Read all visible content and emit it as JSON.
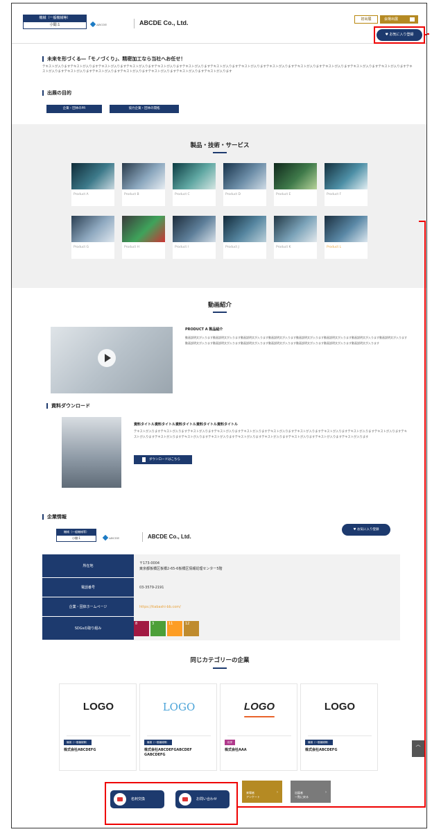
{
  "header": {
    "category_top": "機械（一般機械等）",
    "category_bottom": "小間:1",
    "logo_text": "ABCDE",
    "company_name": "ABCDE Co., Ltd.",
    "visit_button": "初出展",
    "venue_button": "会場出展",
    "favorite_button": "お気に入り登録"
  },
  "intro": {
    "title": "未来を形づくる―「モノづくり」、精密加工なら当社へお任せ！",
    "body": "テキストが入りますテキストが入りますテキストが入りますテキストが入りますテキストが入りますテキストが入りますテキストが入りますテキストが入りますテキストが入りますテキストが入りますテキストが入りますテキストが入りますテキストが入りますテキストが入りますテキストが入りますテキストが入りますテキストが入りますテキストが入りますテキストが入りますテキストが入ります"
  },
  "purpose": {
    "title": "出展の目的",
    "tags": [
      "企業・団体のPR",
      "協力企業・団体の開拓"
    ]
  },
  "products": {
    "title": "製品・技術・サービス",
    "items": [
      {
        "label": "Product A"
      },
      {
        "label": "Product B"
      },
      {
        "label": "Product C"
      },
      {
        "label": "Product D"
      },
      {
        "label": "Product E"
      },
      {
        "label": "Product F"
      },
      {
        "label": "Product G"
      },
      {
        "label": "Product H"
      },
      {
        "label": "Product I"
      },
      {
        "label": "Product J"
      },
      {
        "label": "Product K"
      },
      {
        "label": "Product L"
      }
    ]
  },
  "video": {
    "section_title": "動画紹介",
    "title": "PRODUCT A 製品紹介",
    "body": "動画説明文が入ります動画説明文が入ります動画説明文が入ります動画説明文が入ります動画説明文が入ります動画説明文が入ります動画説明文が入ります動画説明文が入ります動画説明文が入ります動画説明文が入ります動画説明文が入ります動画説明文が入ります動画説明文が入ります動画説明文が入ります動画説明文が入ります"
  },
  "download": {
    "section_title": "資料ダウンロード",
    "title": "資料タイトル資料タイトル資料タイトル資料タイトル資料タイトル",
    "body": "テキストが入りますテキストが入りますテキストが入りますテキストが入りますテキストが入りますテキストが入りますテキストが入りますテキストが入りますテキストが入りますテキストが入りますテキストが入りますテキストが入りますテキストが入りますテキストが入りますテキストが入りますテキストが入りますテキストが入りますテキストが入りますテキストが入ります",
    "button": "ダウンロードはこちら"
  },
  "company": {
    "section_title": "企業情報",
    "category_top": "機械（一般機械等）",
    "category_bottom": "小間:1",
    "logo_text": "ABCDE",
    "name": "ABCDE Co., Ltd.",
    "favorite_button": "お気に入り登録",
    "rows": [
      {
        "key": "所在地",
        "value": "〒173-0004\n東京都板橋区板橋2-65-6板橋区情報処理センター5階"
      },
      {
        "key": "電話番号",
        "value": "03-3579-2191"
      },
      {
        "key": "企業・団体ホームページ",
        "value": "https://itabashi-bb.com/"
      },
      {
        "key": "SDGsの取り組み",
        "value": ""
      }
    ],
    "sdgs": [
      {
        "num": "8",
        "color": "#a21942"
      },
      {
        "num": "3",
        "color": "#4c9f38"
      },
      {
        "num": "11",
        "color": "#fd9d24"
      },
      {
        "num": "12",
        "color": "#bf8b2e"
      }
    ]
  },
  "related": {
    "section_title": "同じカテゴリーの企業",
    "items": [
      {
        "logo": "LOGO",
        "badge": "機械（一般機械等）",
        "badge_color": "#1d3a6e",
        "name": "株式会社ABCDEFG"
      },
      {
        "logo": "LOGO",
        "badge": "機械（一般機械等）",
        "badge_color": "#1d3a6e",
        "name": "株式会社ABCDEFGABCDEF GABCDEFG"
      },
      {
        "logo": "LOGO",
        "badge": "化学",
        "badge_color": "#b03a8c",
        "name": "株式会社AAA"
      },
      {
        "logo": "LOGO",
        "badge": "機械（一般機械等）",
        "badge_color": "#1d3a6e",
        "name": "株式会社ABCDEFG"
      }
    ]
  },
  "actions": {
    "card_button": "名刺交換",
    "contact_button": "お問い合わせ",
    "survey_button": "来場者\nアンケート",
    "list_button": "出展者\n一覧に戻る"
  },
  "colors": {
    "navy": "#1d3a6e",
    "gold": "#b58a23",
    "gray": "#7a7a7a",
    "highlight": "#e00000"
  }
}
